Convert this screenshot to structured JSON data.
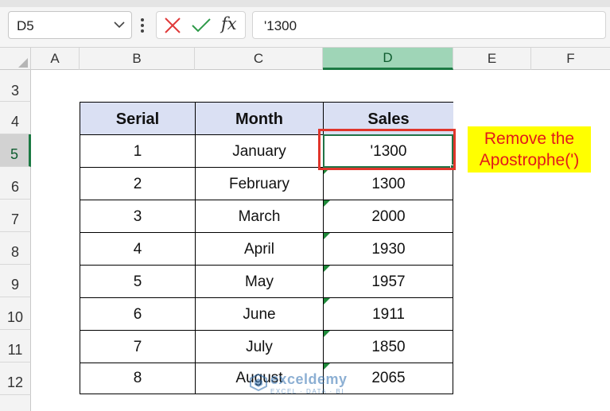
{
  "name_box": {
    "value": "D5"
  },
  "formula_bar": {
    "fx_label": "fx",
    "value": "'1300"
  },
  "columns": [
    "A",
    "B",
    "C",
    "D",
    "E",
    "F"
  ],
  "selected_column": "D",
  "rows": [
    "3",
    "4",
    "5",
    "6",
    "7",
    "8",
    "9",
    "10",
    "11",
    "12"
  ],
  "selected_row": "5",
  "table": {
    "headers": [
      "Serial",
      "Month",
      "Sales"
    ],
    "rows": [
      [
        "1",
        "January",
        "'1300"
      ],
      [
        "2",
        "February",
        "1300"
      ],
      [
        "3",
        "March",
        "2000"
      ],
      [
        "4",
        "April",
        "1930"
      ],
      [
        "5",
        "May",
        "1957"
      ],
      [
        "6",
        "June",
        "1911"
      ],
      [
        "7",
        "July",
        "1850"
      ],
      [
        "8",
        "August",
        "2065"
      ]
    ]
  },
  "callout": {
    "line1": "Remove the",
    "line2": "Apostrophe(')"
  },
  "watermark": {
    "name": "exceldemy",
    "tagline": "EXCEL · DATA · BI"
  },
  "colors": {
    "accent_green": "#217346",
    "header_fill": "#dae0f3",
    "highlight_red": "#e0362c",
    "callout_fill": "#ffff00",
    "callout_text": "#e21a1a"
  }
}
